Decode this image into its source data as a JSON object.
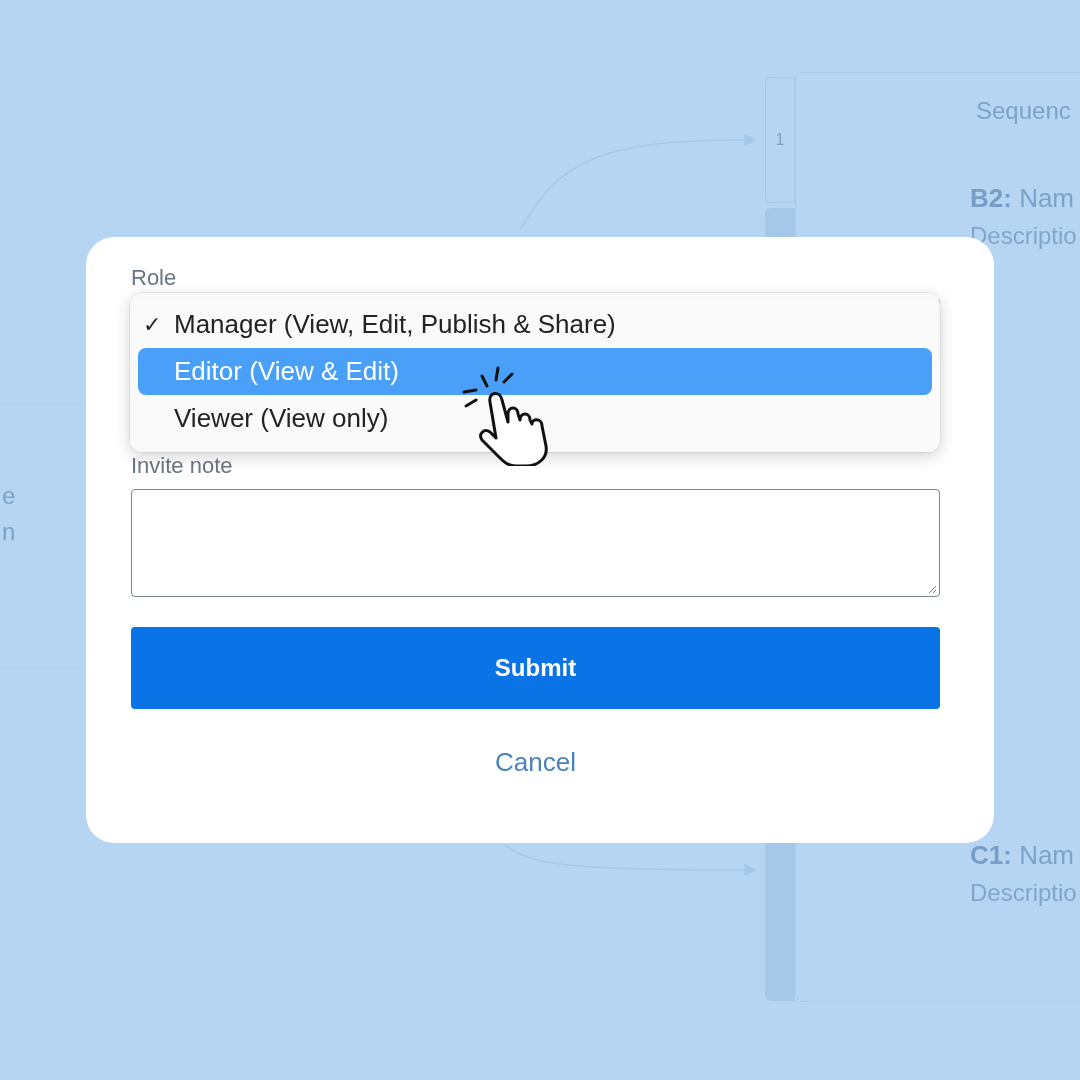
{
  "background": {
    "left_fragments": [
      "e",
      "n"
    ],
    "step_number": "1",
    "card": {
      "title": "Sequenc",
      "blocks": [
        {
          "code": "B2:",
          "name": "Nam",
          "description": "Descriptio"
        },
        {
          "code": "C1:",
          "name": "Nam",
          "description": "Descriptio"
        }
      ]
    }
  },
  "dialog": {
    "role_label": "Role",
    "role_menu": {
      "check_glyph": "✓",
      "options": [
        {
          "label": "Manager (View, Edit, Publish & Share)",
          "checked": true,
          "highlighted": false
        },
        {
          "label": "Editor (View & Edit)",
          "checked": false,
          "highlighted": true
        },
        {
          "label": "Viewer (View only)",
          "checked": false,
          "highlighted": false
        }
      ]
    },
    "note_label": "Invite note",
    "submit": "Submit",
    "cancel": "Cancel"
  }
}
